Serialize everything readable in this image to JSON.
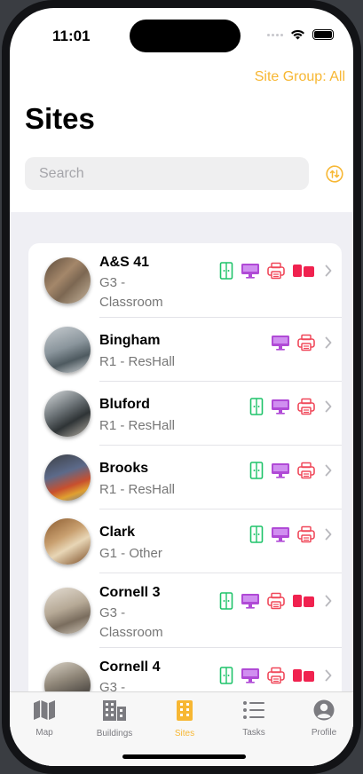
{
  "status": {
    "time": "11:01"
  },
  "header": {
    "site_group": "Site Group: All",
    "title": "Sites"
  },
  "search": {
    "placeholder": "Search"
  },
  "sites": [
    {
      "name": "A&S 41",
      "type": "G3 - Classroom",
      "icons": [
        "door-icon",
        "computer-icon",
        "printer-icon",
        "display-board-icon"
      ]
    },
    {
      "name": "Bingham",
      "type": "R1 - ResHall",
      "icons": [
        "computer-icon",
        "printer-icon"
      ]
    },
    {
      "name": "Bluford",
      "type": "R1 - ResHall",
      "icons": [
        "door-icon",
        "computer-icon",
        "printer-icon"
      ]
    },
    {
      "name": "Brooks",
      "type": "R1 - ResHall",
      "icons": [
        "door-icon",
        "computer-icon",
        "printer-icon"
      ]
    },
    {
      "name": "Clark",
      "type": "G1 - Other",
      "icons": [
        "door-icon",
        "computer-icon",
        "printer-icon"
      ]
    },
    {
      "name": "Cornell 3",
      "type": "G3 - Classroom",
      "icons": [
        "door-icon",
        "computer-icon",
        "printer-icon",
        "display-board-icon"
      ]
    },
    {
      "name": "Cornell 4",
      "type": "G3 -",
      "icons": [
        "door-icon",
        "computer-icon",
        "printer-icon",
        "display-board-icon"
      ]
    }
  ],
  "tabs": [
    {
      "label": "Map",
      "icon": "map-icon"
    },
    {
      "label": "Buildings",
      "icon": "buildings-icon"
    },
    {
      "label": "Sites",
      "icon": "sites-icon",
      "active": true
    },
    {
      "label": "Tasks",
      "icon": "tasks-icon"
    },
    {
      "label": "Profile",
      "icon": "profile-icon"
    }
  ],
  "colors": {
    "accent": "#f7b733",
    "door": "#1fc36a",
    "computer": "#b04ad6",
    "printer": "#f0485a",
    "display": "#f0224f"
  }
}
